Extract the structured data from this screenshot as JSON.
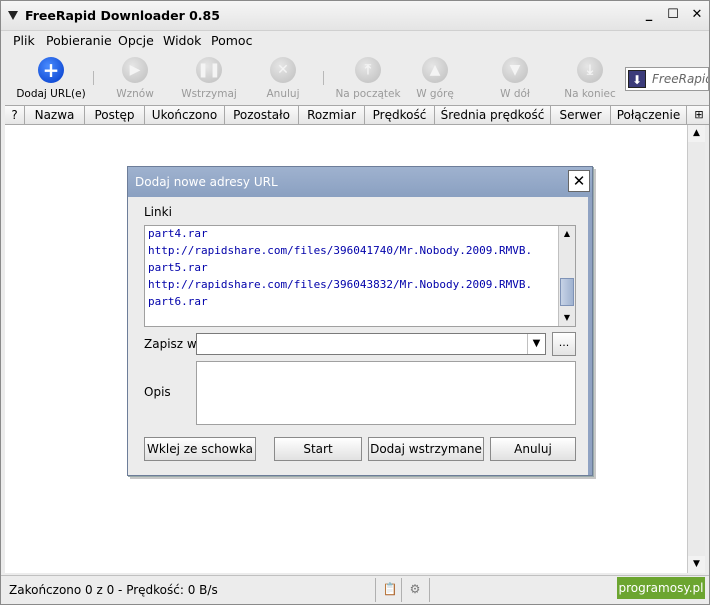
{
  "window": {
    "title": "FreeRapid Downloader 0.85"
  },
  "menu": {
    "items": [
      "Plik",
      "Pobieranie",
      "Opcje",
      "Widok",
      "Pomoc"
    ]
  },
  "toolbar": {
    "buttons": [
      {
        "label": "Dodaj URL(e)",
        "icon": "add-icon",
        "enabled": true
      },
      {
        "label": "Wznów",
        "icon": "play-icon",
        "enabled": false
      },
      {
        "label": "Wstrzymaj",
        "icon": "pause-icon",
        "enabled": false
      },
      {
        "label": "Anuluj",
        "icon": "cancel-icon",
        "enabled": false
      },
      {
        "label": "Na początek",
        "icon": "to-top-icon",
        "enabled": false
      },
      {
        "label": "W górę",
        "icon": "up-icon",
        "enabled": false
      },
      {
        "label": "W dół",
        "icon": "down-icon",
        "enabled": false
      },
      {
        "label": "Na koniec",
        "icon": "to-bottom-icon",
        "enabled": false
      }
    ],
    "logo_text": "FreeRapid"
  },
  "table": {
    "columns": [
      "?",
      "Nazwa",
      "Postęp",
      "Ukończono",
      "Pozostało",
      "Rozmiar",
      "Prędkość",
      "Średnia prędkość",
      "Serwer",
      "Połączenie"
    ]
  },
  "status": {
    "text": "Zakończono 0 z 0 - Prędkość: 0 B/s",
    "promo": "programosy.pl"
  },
  "dialog": {
    "title": "Dodaj nowe adresy URL",
    "links_label": "Linki",
    "links_lines": [
      "part4.rar",
      "http://rapidshare.com/files/396041740/Mr.Nobody.2009.RMVB.",
      "part5.rar",
      "http://rapidshare.com/files/396043832/Mr.Nobody.2009.RMVB.",
      "part6.rar"
    ],
    "save_label": "Zapisz w",
    "save_value": "",
    "browse_label": "...",
    "desc_label": "Opis",
    "desc_value": "",
    "buttons": {
      "paste": "Wklej ze schowka",
      "start": "Start",
      "add_paused": "Dodaj wstrzymane",
      "cancel": "Anuluj"
    }
  }
}
